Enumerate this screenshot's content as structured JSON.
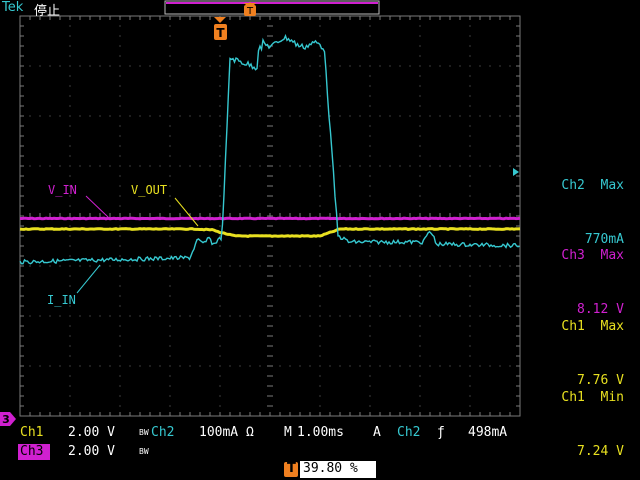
{
  "header": {
    "brand": "Tek",
    "state": "停止"
  },
  "channel_labels": {
    "v_in": "V_IN",
    "v_out": "V_OUT",
    "i_in": "I_IN"
  },
  "measurements": [
    {
      "title": "Ch2  Max",
      "value": "770mA",
      "color": "#36c8d0"
    },
    {
      "title": "Ch3  Max",
      "value": "8.12 V",
      "color": "#d020d0"
    },
    {
      "title": "Ch1  Max",
      "value": "7.76 V",
      "color": "#e8e020"
    },
    {
      "title": "Ch1  Min",
      "value": "7.24 V",
      "color": "#e8e020"
    }
  ],
  "bottom": {
    "ch1_name": "Ch1",
    "ch1_scale": "2.00 V",
    "ch1_bw": "BW",
    "ch2_name": "Ch2",
    "ch2_scale": "100mA Ω",
    "timebase_m": "M",
    "timebase": "1.00ms",
    "trigger_source_a": "A",
    "trigger_ch": "Ch2",
    "trigger_slope": "ƒ",
    "trigger_level": "498mA",
    "ch3_name": "Ch3",
    "ch3_scale": "2.00 V",
    "ch3_bw": "BW",
    "trigger_pos_marker": "T",
    "trigger_pos": "39.80 %"
  },
  "markers": {
    "trigger_top": "T",
    "ref_marker": "3"
  },
  "colors": {
    "ch1": "#e8e020",
    "ch2": "#36c8d0",
    "ch3": "#d020d0",
    "grid": "#7a7a7a",
    "orange": "#f08020"
  }
}
